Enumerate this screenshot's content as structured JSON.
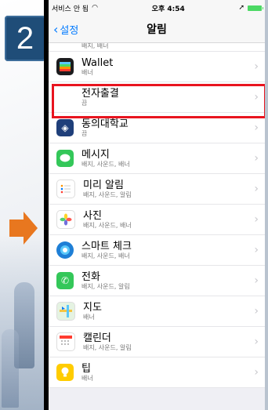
{
  "badge": "2",
  "status": {
    "carrier": "서비스 안 됨",
    "time": "오후 4:54"
  },
  "nav": {
    "back_label": "설정",
    "title": "알림"
  },
  "rows": [
    {
      "title": "",
      "sub": "배지, 배너",
      "icon": "app-icon-partial"
    },
    {
      "title": "Wallet",
      "sub": "배너",
      "icon": "wallet-icon"
    },
    {
      "title": "전자출결",
      "sub": "끔",
      "icon": "none"
    },
    {
      "title": "동의대학교",
      "sub": "끔",
      "icon": "university-icon"
    },
    {
      "title": "메시지",
      "sub": "배지, 사운드, 배너",
      "icon": "messages-icon"
    },
    {
      "title": "미리 알림",
      "sub": "배지, 사운드, 알림",
      "icon": "reminders-icon"
    },
    {
      "title": "사진",
      "sub": "배지, 사운드, 배너",
      "icon": "photos-icon"
    },
    {
      "title": "스마트 체크",
      "sub": "배지, 사운드, 배너",
      "icon": "smart-check-icon"
    },
    {
      "title": "전화",
      "sub": "배지, 사운드, 알림",
      "icon": "phone-icon"
    },
    {
      "title": "지도",
      "sub": "배너",
      "icon": "maps-icon"
    },
    {
      "title": "캘린더",
      "sub": "배지, 사운드, 알림",
      "icon": "calendar-icon"
    },
    {
      "title": "팁",
      "sub": "배너",
      "icon": "tips-icon"
    }
  ],
  "colors": {
    "highlight": "#e8141f",
    "badge": "#1f4d78",
    "arrow": "#e8771f",
    "ios_blue": "#007aff"
  }
}
